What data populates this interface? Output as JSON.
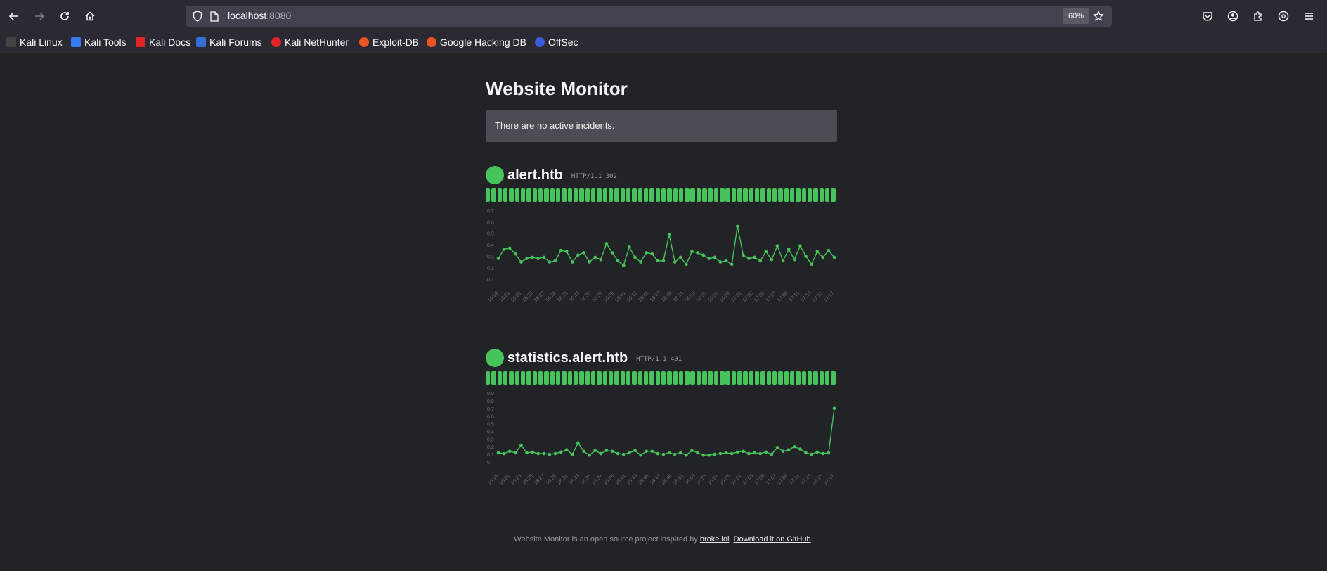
{
  "browser": {
    "url_host": "localhost",
    "url_port": ":8080",
    "zoom": "60%",
    "bookmarks": [
      {
        "label": "Kali Linux",
        "color": "#1f1f1f"
      },
      {
        "label": "Kali Tools",
        "color": "#367bf0"
      },
      {
        "label": "Kali Docs",
        "color": "#e2232a"
      },
      {
        "label": "Kali Forums",
        "color": "#2f6fd6"
      },
      {
        "label": "Kali NetHunter",
        "color": "#e2232a"
      },
      {
        "label": "Exploit-DB",
        "color": "#e95420"
      },
      {
        "label": "Google Hacking DB",
        "color": "#e95420"
      },
      {
        "label": "OffSec",
        "color": "#3b5bdb"
      }
    ]
  },
  "page": {
    "title": "Website Monitor",
    "incident_text": "There are no active incidents."
  },
  "sites": [
    {
      "name": "alert.htb",
      "status": "HTTP/1.1 302",
      "status_color": "#46c35a",
      "bar_count": 60
    },
    {
      "name": "statistics.alert.htb",
      "status": "HTTP/1.1 401",
      "status_color": "#46c35a",
      "bar_count": 60
    }
  ],
  "chart_data": [
    {
      "type": "line",
      "series": [
        {
          "values": [
            0.28,
            0.36,
            0.37,
            0.32,
            0.25,
            0.28,
            0.29,
            0.28,
            0.29,
            0.25,
            0.26,
            0.35,
            0.34,
            0.25,
            0.31,
            0.33,
            0.25,
            0.29,
            0.27,
            0.41,
            0.33,
            0.26,
            0.22,
            0.38,
            0.29,
            0.25,
            0.33,
            0.32,
            0.26,
            0.26,
            0.49,
            0.25,
            0.29,
            0.23,
            0.34,
            0.33,
            0.31,
            0.28,
            0.29,
            0.25,
            0.26,
            0.23,
            0.56,
            0.31,
            0.28,
            0.29,
            0.26,
            0.34,
            0.27,
            0.39,
            0.26,
            0.36,
            0.27,
            0.39,
            0.3,
            0.23,
            0.34,
            0.29,
            0.35,
            0.29
          ]
        }
      ],
      "ylim": [
        0.1,
        0.7
      ],
      "yticks": [
        "0.1",
        "0.2",
        "0.3",
        "0.4",
        "0.5",
        "0.6",
        "0.7"
      ],
      "xticks": [
        "16:19",
        "16:21",
        "16:23",
        "16:25",
        "16:27",
        "16:29",
        "16:31",
        "16:33",
        "16:35",
        "16:37",
        "16:39",
        "16:41",
        "16:43",
        "16:45",
        "16:47",
        "16:49",
        "16:51",
        "16:53",
        "16:55",
        "16:57",
        "16:59",
        "17:01",
        "17:03",
        "17:05",
        "17:07",
        "17:09",
        "17:11",
        "17:13",
        "17:15",
        "17:17"
      ],
      "color": "#46c35a"
    },
    {
      "type": "line",
      "series": [
        {
          "values": [
            0.12,
            0.11,
            0.14,
            0.12,
            0.22,
            0.12,
            0.13,
            0.11,
            0.11,
            0.1,
            0.11,
            0.13,
            0.16,
            0.1,
            0.25,
            0.14,
            0.09,
            0.15,
            0.11,
            0.15,
            0.14,
            0.11,
            0.1,
            0.12,
            0.15,
            0.09,
            0.14,
            0.14,
            0.11,
            0.1,
            0.12,
            0.1,
            0.12,
            0.09,
            0.15,
            0.12,
            0.09,
            0.09,
            0.1,
            0.11,
            0.12,
            0.11,
            0.13,
            0.14,
            0.11,
            0.12,
            0.11,
            0.13,
            0.1,
            0.19,
            0.14,
            0.16,
            0.2,
            0.17,
            0.12,
            0.1,
            0.13,
            0.11,
            0.12,
            0.7
          ]
        }
      ],
      "ylim": [
        0,
        0.9
      ],
      "yticks": [
        "0",
        "0.1",
        "0.2",
        "0.3",
        "0.4",
        "0.5",
        "0.6",
        "0.7",
        "0.8",
        "0.9"
      ],
      "xticks": [
        "16:19",
        "16:21",
        "16:23",
        "16:25",
        "16:27",
        "16:29",
        "16:31",
        "16:33",
        "16:35",
        "16:37",
        "16:39",
        "16:41",
        "16:43",
        "16:45",
        "16:47",
        "16:49",
        "16:51",
        "16:53",
        "16:55",
        "16:57",
        "16:59",
        "17:01",
        "17:03",
        "17:05",
        "17:07",
        "17:09",
        "17:11",
        "17:13",
        "17:15",
        "17:17"
      ],
      "color": "#46c35a"
    }
  ],
  "footer": {
    "text_before": "Website Monitor is an open source project inspired by",
    "link1": "broke.lol",
    "separator": ".",
    "link2": "Download it on GitHub",
    "text_after": "."
  }
}
